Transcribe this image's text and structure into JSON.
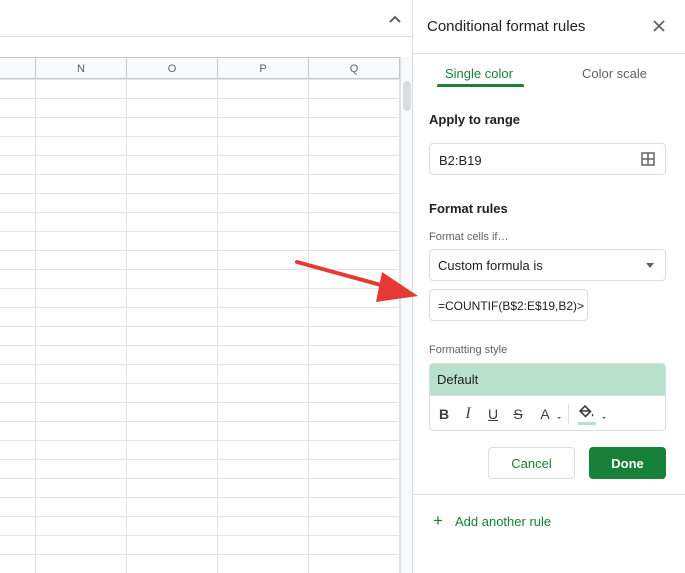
{
  "sheet": {
    "columns": [
      "N",
      "O",
      "P",
      "Q"
    ],
    "collapse_icon": "chevron-up-icon"
  },
  "panel": {
    "title": "Conditional format rules",
    "close_icon": "close-icon",
    "tabs": [
      {
        "label": "Single color",
        "active": true
      },
      {
        "label": "Color scale",
        "active": false
      }
    ],
    "apply_to_range": {
      "label": "Apply to range",
      "value": "B2:B19",
      "icon": "grid-select-icon"
    },
    "format_rules": {
      "label": "Format rules",
      "condition_label": "Format cells if…",
      "condition_value": "Custom formula is",
      "formula_value": "=COUNTIF(B$2:E$19,B2)>"
    },
    "formatting_style": {
      "label": "Formatting style",
      "preset": "Default",
      "preview_color": "#b7e1cd",
      "tools": {
        "bold": "B",
        "italic": "I",
        "underline": "U",
        "strikethrough": "S",
        "text_color": "A"
      }
    },
    "buttons": {
      "cancel": "Cancel",
      "done": "Done"
    },
    "add_rule": "Add another rule"
  },
  "colors": {
    "accent": "#188038",
    "annotation_arrow": "#e53935"
  }
}
